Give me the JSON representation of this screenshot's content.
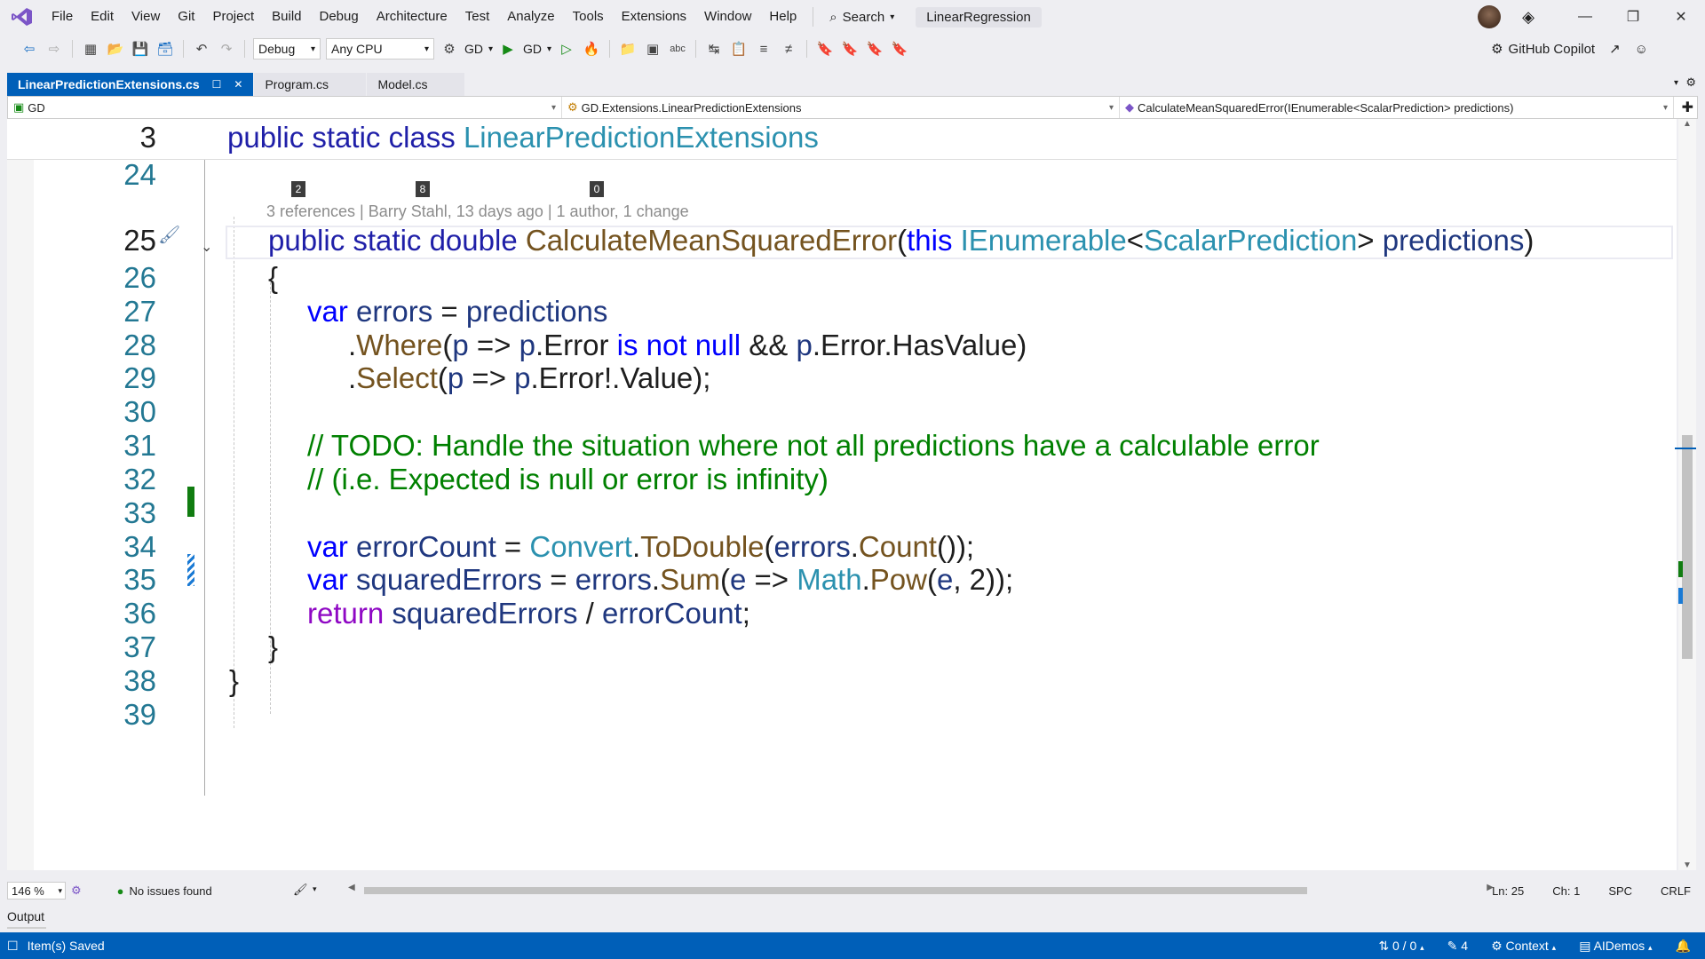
{
  "menubar": {
    "items": [
      "File",
      "Edit",
      "View",
      "Git",
      "Project",
      "Build",
      "Debug",
      "Architecture",
      "Test",
      "Analyze",
      "Tools",
      "Extensions",
      "Window",
      "Help"
    ],
    "search_label": "Search",
    "solution_name": "LinearRegression"
  },
  "toolbar": {
    "config": "Debug",
    "platform": "Any CPU",
    "startup_project": "GD",
    "run_target": "GD",
    "copilot_label": "GitHub Copilot"
  },
  "tabs": [
    {
      "label": "LinearPredictionExtensions.cs",
      "active": true
    },
    {
      "label": "Program.cs",
      "active": false
    },
    {
      "label": "Model.cs",
      "active": false
    }
  ],
  "navbar": {
    "project": "GD",
    "type": "GD.Extensions.LinearPredictionExtensions",
    "member": "CalculateMeanSquaredError(IEnumerable<ScalarPrediction> predictions)"
  },
  "editor": {
    "sticky_line_number": "3",
    "sticky_code": "public static class LinearPredictionExtensions",
    "codelens": {
      "text": "3 references | Barry Stahl, 13 days ago | 1 author, 1 change",
      "badges": [
        "2",
        "8",
        "0"
      ]
    },
    "line_numbers": [
      "24",
      "25",
      "26",
      "27",
      "28",
      "29",
      "30",
      "31",
      "32",
      "33",
      "34",
      "35",
      "36",
      "37",
      "38",
      "39"
    ],
    "comment_1": "// TODO: Handle the situation where not all predictions have a calculable error",
    "comment_2": "// (i.e. Expected is null or error is infinity)"
  },
  "editor_status": {
    "zoom": "146 %",
    "issues": "No issues found",
    "line": "Ln: 25",
    "column": "Ch: 1",
    "whitespace": "SPC",
    "line_ending": "CRLF"
  },
  "output_label": "Output",
  "statusbar": {
    "message": "Item(s) Saved",
    "git_changes": "0 / 0",
    "pencil_count": "4",
    "context": "Context",
    "repo": "AIDemos"
  },
  "colors": {
    "accent": "#005fb8",
    "keyword": "#0000ff",
    "type": "#2b91af",
    "method": "#74531f",
    "comment": "#008000",
    "change_marker": "#107c10"
  }
}
